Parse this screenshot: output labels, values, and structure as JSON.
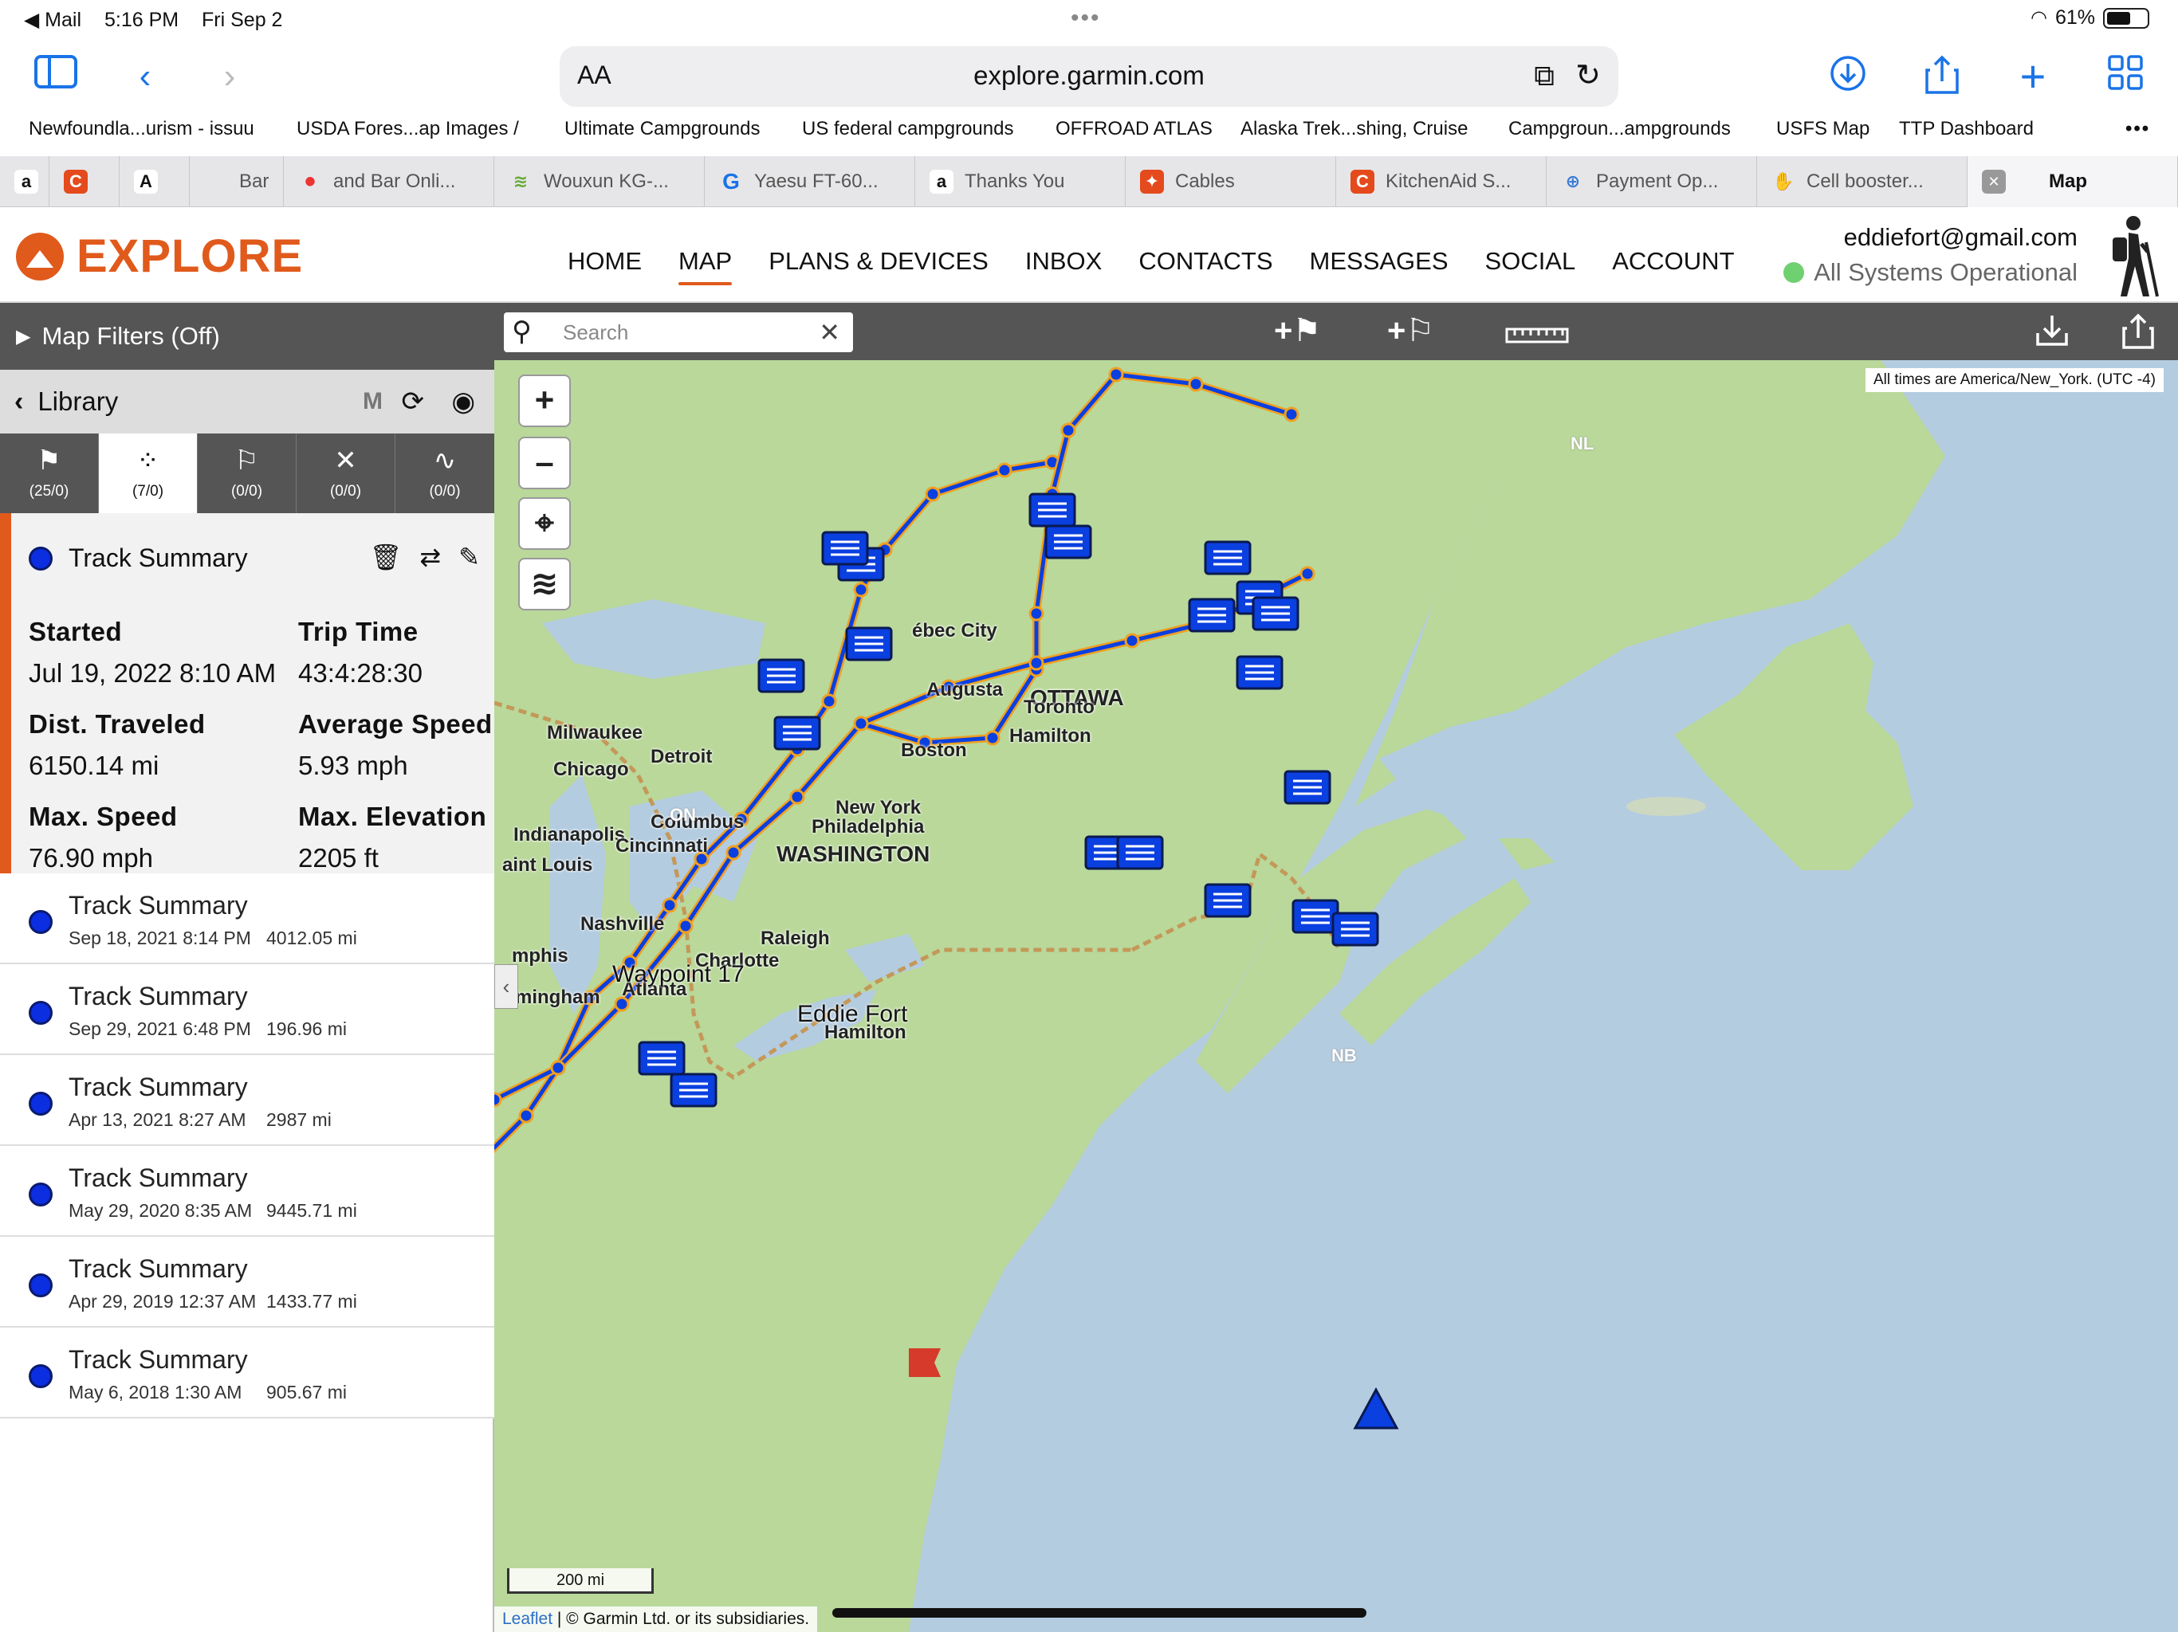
{
  "status_bar": {
    "back_app": "◀ Mail",
    "time": "5:16 PM",
    "date": "Fri Sep 2",
    "battery": "61%",
    "battery_level": 0.61
  },
  "browser": {
    "text_size": "AA",
    "url": "explore.garmin.com",
    "favorites": [
      "Newfoundla...urism - issuu",
      "USDA Fores...ap Images /",
      "Ultimate Campgrounds",
      "US federal campgrounds",
      "OFFROAD ATLAS",
      "Alaska Trek...shing, Cruise",
      "Campgroun...ampgrounds",
      "USFS Map",
      "TTP Dashboard"
    ],
    "tabs": [
      {
        "icon": "amazon-icon",
        "glyph": "a",
        "label": ""
      },
      {
        "icon": "c-orange-icon",
        "glyph": "C",
        "label": ""
      },
      {
        "icon": "a-slash-icon",
        "glyph": "A",
        "label": ""
      },
      {
        "icon": "blank-icon",
        "glyph": "",
        "label": "Bar"
      },
      {
        "icon": "red-dot-icon",
        "glyph": "•",
        "label": "and Bar Onli..."
      },
      {
        "icon": "wifi-icon",
        "glyph": "≋",
        "label": "Wouxun KG-..."
      },
      {
        "icon": "google-icon",
        "glyph": "G",
        "label": "Yaesu FT-60..."
      },
      {
        "icon": "amazon-icon",
        "glyph": "a",
        "label": "Thanks You"
      },
      {
        "icon": "runner-icon",
        "glyph": "✦",
        "label": "Cables"
      },
      {
        "icon": "c-orange-icon",
        "glyph": "C",
        "label": "KitchenAid S..."
      },
      {
        "icon": "globe-icon",
        "glyph": "⊕",
        "label": "Payment Op..."
      },
      {
        "icon": "hand-icon",
        "glyph": "✋",
        "label": "Cell booster..."
      },
      {
        "icon": "close-icon",
        "glyph": "✕",
        "label": "Map"
      }
    ]
  },
  "header": {
    "logo_text": "EXPLORE",
    "nav": [
      "HOME",
      "MAP",
      "PLANS & DEVICES",
      "INBOX",
      "CONTACTS",
      "MESSAGES",
      "SOCIAL",
      "ACCOUNT"
    ],
    "active_nav": "MAP",
    "email": "eddiefort@gmail.com",
    "system_status": "All Systems Operational"
  },
  "sidebar": {
    "map_filters": "Map Filters (Off)",
    "library_title": "Library",
    "library_m": "M",
    "tabs": [
      {
        "icon": "flag-icon",
        "glyph": "⚑",
        "count": "(25/0)"
      },
      {
        "icon": "footprints-icon",
        "glyph": "⁘",
        "count": "(7/0)"
      },
      {
        "icon": "route-flags-icon",
        "glyph": "⚐",
        "count": "(0/0)"
      },
      {
        "icon": "activity-icon",
        "glyph": "✕",
        "count": "(0/0)"
      },
      {
        "icon": "route-icon",
        "glyph": "∿",
        "count": "(0/0)"
      }
    ],
    "selected_track": {
      "name": "Track Summary",
      "stats": [
        {
          "label": "Started",
          "value": "Jul 19, 2022 8:10 AM"
        },
        {
          "label": "Trip Time",
          "value": "43:4:28:30"
        },
        {
          "label": "Dist. Traveled",
          "value": "6150.14 mi"
        },
        {
          "label": "Average Speed",
          "value": "5.93 mph"
        },
        {
          "label": "Max. Speed",
          "value": "76.90 mph"
        },
        {
          "label": "Max. Elevation",
          "value": "2205 ft"
        }
      ]
    },
    "tracks": [
      {
        "name": "Track Summary",
        "date": "Sep 18, 2021 8:14 PM",
        "distance": "4012.05 mi"
      },
      {
        "name": "Track Summary",
        "date": "Sep 29, 2021 6:48 PM",
        "distance": "196.96 mi"
      },
      {
        "name": "Track Summary",
        "date": "Apr 13, 2021 8:27 AM",
        "distance": "2987 mi"
      },
      {
        "name": "Track Summary",
        "date": "May 29, 2020 8:35 AM",
        "distance": "9445.71 mi"
      },
      {
        "name": "Track Summary",
        "date": "Apr 29, 2019 12:37 AM",
        "distance": "1433.77 mi"
      },
      {
        "name": "Track Summary",
        "date": "May 6, 2018 1:30 AM",
        "distance": "905.67 mi"
      }
    ]
  },
  "map": {
    "search_placeholder": "Search",
    "timezone_note": "All times are America/New_York. (UTC -4)",
    "scale": "200 mi",
    "attribution_link": "Leaflet",
    "attribution_text": " | © Garmin Ltd. or its subsidiaries.",
    "cities": [
      "OTTAWA",
      "Toronto",
      "Hamilton",
      "Milwaukee",
      "Chicago",
      "Detroit",
      "Augusta",
      "Boston",
      "New York",
      "Philadelphia",
      "WASHINGTON",
      "Columbus",
      "Indianapolis",
      "Cincinnati",
      "aint Louis",
      "Nashville",
      "mphis",
      "Charlotte",
      "Raleigh",
      "Atlanta",
      "irmingham",
      "Hamilton",
      "ébec City"
    ],
    "regions": [
      "ON",
      "NL",
      "NB"
    ],
    "waypoint_labels": [
      "Waypoint 17",
      "Eddie Fort"
    ]
  },
  "colors": {
    "brand_orange": "#e05a1c",
    "track_blue": "#0a3fe0",
    "track_outline": "#f0a020",
    "water": "#b4cce0",
    "land": "#b9d89a",
    "status_green": "#6fd06f"
  }
}
